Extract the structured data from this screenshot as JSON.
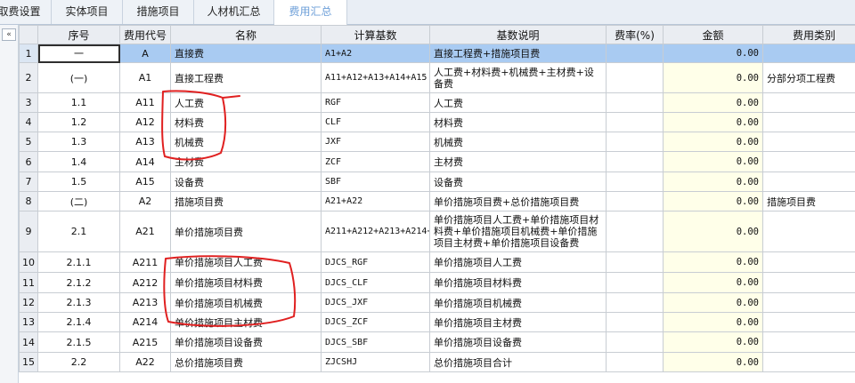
{
  "tabs": [
    {
      "label": "取费设置",
      "active": false
    },
    {
      "label": "实体项目",
      "active": false
    },
    {
      "label": "措施项目",
      "active": false
    },
    {
      "label": "人材机汇总",
      "active": false
    },
    {
      "label": "费用汇总",
      "active": true
    }
  ],
  "collapse_label": "«",
  "columns": [
    "序号",
    "费用代号",
    "名称",
    "计算基数",
    "基数说明",
    "费率(%)",
    "金额",
    "费用类别"
  ],
  "rows": [
    {
      "rn": "1",
      "seq": "一",
      "code": "A",
      "name": "直接费",
      "base": "A1+A2",
      "desc": "直接工程费+措施项目费",
      "rate": "",
      "amount": "0.00",
      "category": ""
    },
    {
      "rn": "2",
      "seq": "(一)",
      "code": "A1",
      "name": "直接工程费",
      "base": "A11+A12+A13+A14+A15",
      "desc": "人工费+材料费+机械费+主材费+设备费",
      "rate": "",
      "amount": "0.00",
      "category": "分部分项工程费"
    },
    {
      "rn": "3",
      "seq": "1.1",
      "code": "A11",
      "name": "人工费",
      "base": "RGF",
      "desc": "人工费",
      "rate": "",
      "amount": "0.00",
      "category": ""
    },
    {
      "rn": "4",
      "seq": "1.2",
      "code": "A12",
      "name": "材料费",
      "base": "CLF",
      "desc": "材料费",
      "rate": "",
      "amount": "0.00",
      "category": ""
    },
    {
      "rn": "5",
      "seq": "1.3",
      "code": "A13",
      "name": "机械费",
      "base": "JXF",
      "desc": "机械费",
      "rate": "",
      "amount": "0.00",
      "category": ""
    },
    {
      "rn": "6",
      "seq": "1.4",
      "code": "A14",
      "name": "主材费",
      "base": "ZCF",
      "desc": "主材费",
      "rate": "",
      "amount": "0.00",
      "category": ""
    },
    {
      "rn": "7",
      "seq": "1.5",
      "code": "A15",
      "name": "设备费",
      "base": "SBF",
      "desc": "设备费",
      "rate": "",
      "amount": "0.00",
      "category": ""
    },
    {
      "rn": "8",
      "seq": "(二)",
      "code": "A2",
      "name": "措施项目费",
      "base": "A21+A22",
      "desc": "单价措施项目费+总价措施项目费",
      "rate": "",
      "amount": "0.00",
      "category": "措施项目费"
    },
    {
      "rn": "9",
      "seq": "2.1",
      "code": "A21",
      "name": "单价措施项目费",
      "base": "A211+A212+A213+A214+A215",
      "desc": "单价措施项目人工费+单价措施项目材料费+单价措施项目机械费+单价措施项目主材费+单价措施项目设备费",
      "rate": "",
      "amount": "0.00",
      "category": ""
    },
    {
      "rn": "10",
      "seq": "2.1.1",
      "code": "A211",
      "name": "单价措施项目人工费",
      "base": "DJCS_RGF",
      "desc": "单价措施项目人工费",
      "rate": "",
      "amount": "0.00",
      "category": ""
    },
    {
      "rn": "11",
      "seq": "2.1.2",
      "code": "A212",
      "name": "单价措施项目材料费",
      "base": "DJCS_CLF",
      "desc": "单价措施项目材料费",
      "rate": "",
      "amount": "0.00",
      "category": ""
    },
    {
      "rn": "12",
      "seq": "2.1.3",
      "code": "A213",
      "name": "单价措施项目机械费",
      "base": "DJCS_JXF",
      "desc": "单价措施项目机械费",
      "rate": "",
      "amount": "0.00",
      "category": ""
    },
    {
      "rn": "13",
      "seq": "2.1.4",
      "code": "A214",
      "name": "单价措施项目主材费",
      "base": "DJCS_ZCF",
      "desc": "单价措施项目主材费",
      "rate": "",
      "amount": "0.00",
      "category": ""
    },
    {
      "rn": "14",
      "seq": "2.1.5",
      "code": "A215",
      "name": "单价措施项目设备费",
      "base": "DJCS_SBF",
      "desc": "单价措施项目设备费",
      "rate": "",
      "amount": "0.00",
      "category": ""
    },
    {
      "rn": "15",
      "seq": "2.2",
      "code": "A22",
      "name": "总价措施项目费",
      "base": "ZJCSHJ",
      "desc": "总价措施项目合计",
      "rate": "",
      "amount": "0.00",
      "category": ""
    }
  ],
  "colors": {
    "selection": "#a9cbf2",
    "amount_bg": "#ffffe9",
    "active_tab": "#6d9fd8",
    "annotation": "#e02020"
  }
}
